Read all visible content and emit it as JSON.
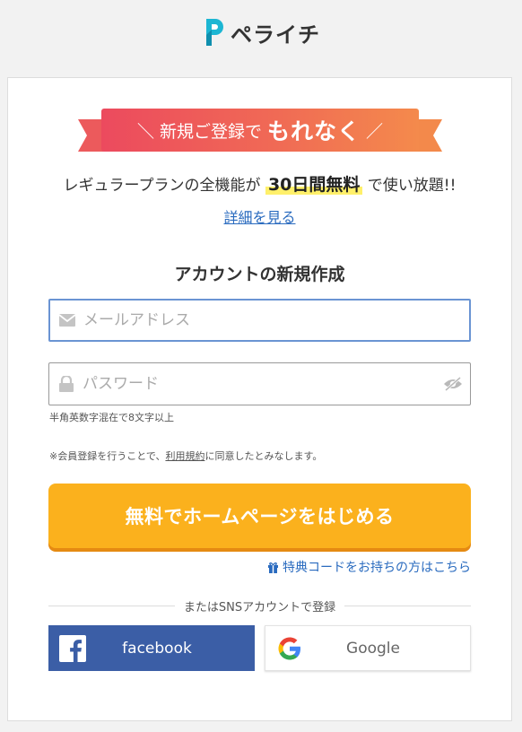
{
  "brand": {
    "name": "ペライチ",
    "logo_color": "#1cb6d3"
  },
  "promo": {
    "ribbon_prefix": "＼ 新規ご登録で",
    "ribbon_emphasis": "もれなく",
    "ribbon_suffix": "／",
    "line_before": "レギュラープランの全機能が",
    "line_highlight": "30日間無料",
    "line_after": "で使い放題!!",
    "detail_link": "詳細を見る"
  },
  "form": {
    "title": "アカウントの新規作成",
    "email_placeholder": "メールアドレス",
    "email_value": "",
    "password_placeholder": "パスワード",
    "password_value": "",
    "password_hint": "半角英数字混在で8文字以上",
    "terms_before": "※会員登録を行うことで、",
    "terms_link": "利用規約",
    "terms_after": "に同意したとみなします。",
    "submit_label": "無料でホームページをはじめる",
    "coupon_link": "特典コードをお持ちの方はこちら"
  },
  "sns": {
    "divider_label": "またはSNSアカウントで登録",
    "facebook_label": "facebook",
    "google_label": "Google"
  },
  "icons": {
    "email": "envelope-icon",
    "password": "lock-icon",
    "visibility": "eye-slash-icon",
    "coupon": "gift-icon",
    "facebook": "facebook-icon",
    "google": "google-icon"
  },
  "colors": {
    "cta": "#fbb11d",
    "cta_shadow": "#e58a12",
    "link": "#2a6bbf",
    "facebook": "#3b5ea6",
    "ribbon_start": "#ec4a5e",
    "ribbon_end": "#f48a4c",
    "highlight": "#fff06a"
  }
}
